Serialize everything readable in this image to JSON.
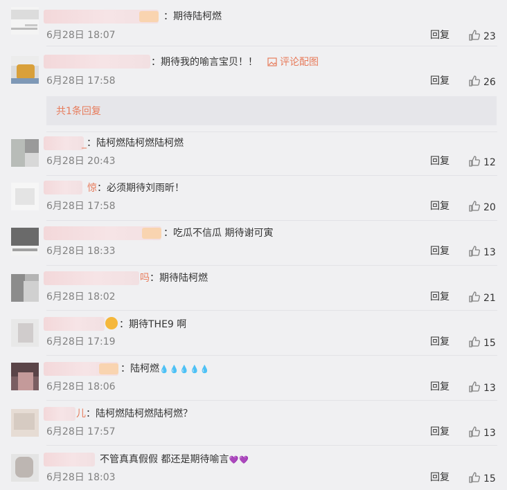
{
  "like_color": "#808080",
  "accent_color": "#e77b5b",
  "sub_replies": "共1条回复",
  "comments": [
    {
      "text": "期待陆柯燃",
      "user_tail": "",
      "date": "6月28日 18:07",
      "reply": "回复",
      "likes": "23"
    },
    {
      "text": "期待我的喻言宝贝！！",
      "user_tail": "",
      "date": "6月28日 17:58",
      "reply": "回复",
      "likes": "26",
      "pic": "评论配图"
    },
    {
      "text": "陆柯燃陆柯燃陆柯燃",
      "user_tail": "_",
      "date": "6月28日 20:43",
      "reply": "回复",
      "likes": "12"
    },
    {
      "text": "必须期待刘雨昕！",
      "user_tail": "惊",
      "date": "6月28日 17:58",
      "reply": "回复",
      "likes": "20"
    },
    {
      "text": "吃瓜不信瓜  期待谢可寅",
      "user_tail": "",
      "date": "6月28日 18:33",
      "reply": "回复",
      "likes": "13"
    },
    {
      "text": "期待陆柯燃",
      "user_tail": "吗",
      "date": "6月28日 18:02",
      "reply": "回复",
      "likes": "21"
    },
    {
      "text": "期待THE9 啊",
      "user_tail": "",
      "date": "6月28日 17:19",
      "reply": "回复",
      "likes": "15"
    },
    {
      "text": "陆柯燃",
      "user_tail": "",
      "date": "6月28日 18:06",
      "reply": "回复",
      "likes": "13",
      "emoji": "💧💧💧💧💧"
    },
    {
      "text": "陆柯燃陆柯燃陆柯燃？",
      "user_tail": "儿",
      "date": "6月28日 17:57",
      "reply": "回复",
      "likes": "13"
    },
    {
      "text": "不管真真假假 都还是期待喻言",
      "user_tail": "",
      "date": "6月28日 18:03",
      "reply": "回复",
      "likes": "15",
      "emoji": "💜💜"
    }
  ]
}
